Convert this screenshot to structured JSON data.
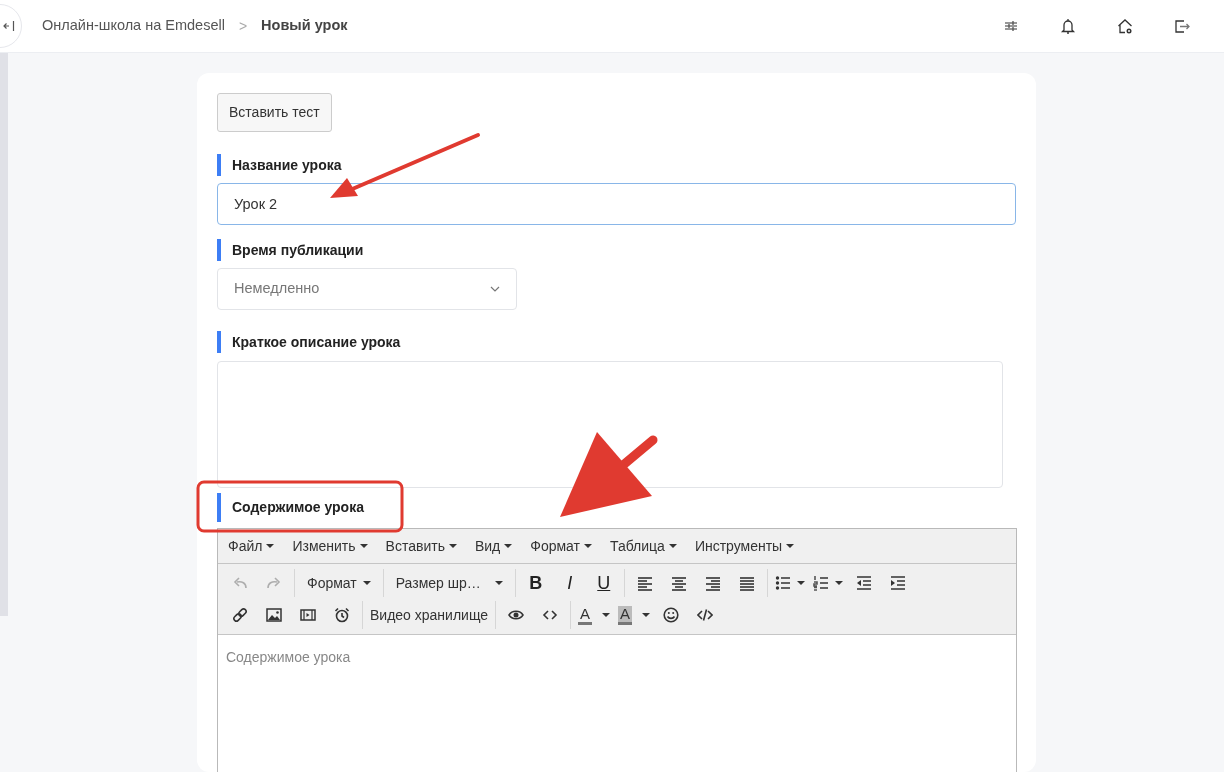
{
  "header": {
    "breadcrumb": [
      {
        "label": "Онлайн-школа на Emdesell",
        "current": false
      },
      {
        "label": "Новый урок",
        "current": true
      }
    ],
    "separator": ">"
  },
  "form": {
    "insert_test_button": "Вставить тест",
    "fields": [
      {
        "kind": "text",
        "label": "Название урока",
        "value": "Урок 2",
        "focused": true
      },
      {
        "kind": "select",
        "label": "Время публикации",
        "value": "Немедленно",
        "focused": false
      },
      {
        "kind": "textarea",
        "label": "Краткое описание урока",
        "focused": false
      }
    ],
    "editor": {
      "label": "Содержимое урока",
      "menu": [
        {
          "label": "Файл"
        },
        {
          "label": "Изменить"
        },
        {
          "label": "Вставить"
        },
        {
          "label": "Вид"
        },
        {
          "label": "Формат"
        },
        {
          "label": "Таблица"
        },
        {
          "label": "Инструменты"
        }
      ],
      "toolbar_rows": [
        [
          [
            {
              "kind": "tool",
              "disabled": true
            },
            {
              "kind": "tool",
              "disabled": true
            }
          ],
          [
            {
              "kind": "dropdown",
              "label": "Формат"
            }
          ],
          [
            {
              "kind": "dropdown",
              "label": "Размер шр…"
            }
          ],
          [
            {
              "kind": "bold",
              "label": "B"
            },
            {
              "kind": "italic",
              "label": "I"
            },
            {
              "kind": "underline",
              "label": "U"
            }
          ],
          [
            {
              "kind": "tool",
              "disabled": false
            },
            {
              "kind": "tool",
              "disabled": false
            },
            {
              "kind": "tool",
              "disabled": false
            },
            {
              "kind": "tool",
              "disabled": false
            }
          ],
          [
            {
              "kind": "splittool",
              "disabled": false
            },
            {
              "kind": "splittool",
              "disabled": false
            },
            {
              "kind": "tool",
              "disabled": false
            },
            {
              "kind": "tool",
              "disabled": false
            }
          ]
        ],
        [
          [
            {
              "kind": "tool",
              "disabled": false
            },
            {
              "kind": "tool",
              "disabled": false
            },
            {
              "kind": "tool",
              "disabled": false
            },
            {
              "kind": "tool",
              "disabled": false
            }
          ],
          [
            {
              "kind": "button",
              "label": "Видео хранилище"
            }
          ],
          [
            {
              "kind": "tool",
              "disabled": false
            },
            {
              "kind": "tool",
              "disabled": false
            }
          ],
          [
            {
              "kind": "textcolor",
              "label": "A"
            },
            {
              "kind": "bgcolor",
              "label": "A"
            },
            {
              "kind": "tool",
              "disabled": false
            },
            {
              "kind": "tool",
              "disabled": false
            }
          ]
        ]
      ],
      "placeholder": "Содержимое урока"
    }
  }
}
